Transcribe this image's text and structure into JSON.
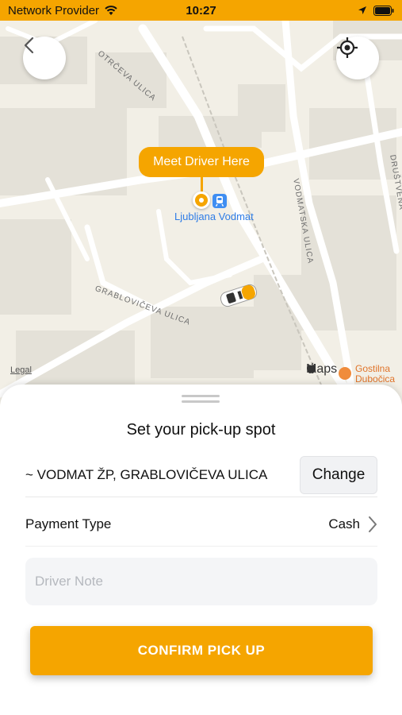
{
  "status_bar": {
    "carrier": "Network Provider",
    "time": "10:27",
    "icons": [
      "wifi-icon",
      "location-arrow-icon",
      "battery-icon"
    ]
  },
  "map": {
    "streets": [
      "OTRČEVA ULICA",
      "VODMATSKA ULICA",
      "DRUŠTVENA",
      "GRABLOVIČEVA ULICA"
    ],
    "pin_label": "Meet Driver Here",
    "station_name": "Ljubljana Vodmat",
    "legal": "Legal",
    "maps_brand": "Maps",
    "poi_name": "Gostilna Dubočica",
    "buttons": {
      "back_icon": "chevron-left-icon",
      "locate_icon": "crosshair-icon"
    }
  },
  "sheet": {
    "title": "Set your pick-up spot",
    "address": "~ VODMAT ŽP, GRABLOVIČEVA ULICA",
    "change_label": "Change",
    "payment_label": "Payment Type",
    "payment_value": "Cash",
    "note_placeholder": "Driver Note",
    "confirm_label": "CONFIRM PICK UP"
  },
  "colors": {
    "accent": "#F5A500",
    "map_bg": "#F2EFE6",
    "station_text": "#2E7CE6"
  }
}
